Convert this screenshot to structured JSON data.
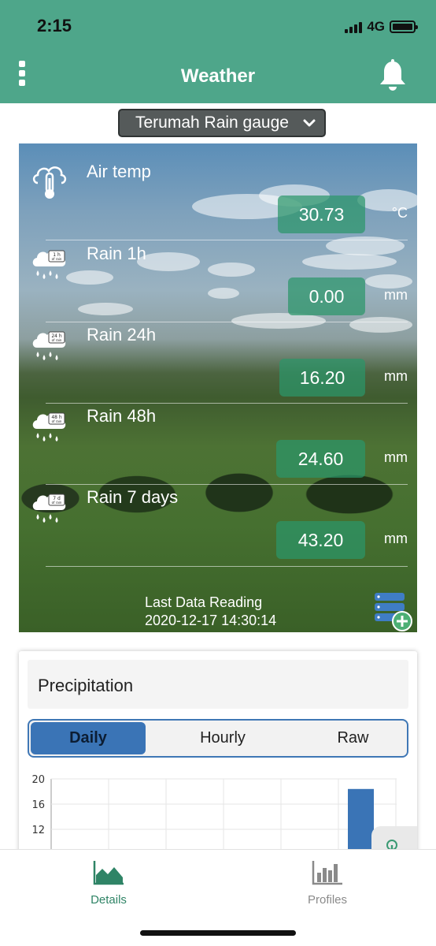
{
  "status_bar": {
    "time": "2:15",
    "network": "4G"
  },
  "header": {
    "title": "Weather",
    "menu_icon": "more-vertical-icon",
    "bell_icon": "bell-icon"
  },
  "device_selector": {
    "selected": "Terumah Rain gauge"
  },
  "readings": [
    {
      "label": "Air temp",
      "value": "30.73",
      "unit": "°C",
      "icon": "thermometer-cloud-icon",
      "badge": ""
    },
    {
      "label": "Rain 1h",
      "value": "0.00",
      "unit": "mm",
      "icon": "rain-cloud-icon",
      "badge": "1 h\nof rain"
    },
    {
      "label": "Rain 24h",
      "value": "16.20",
      "unit": "mm",
      "icon": "rain-cloud-icon",
      "badge": "24 h\nof rain"
    },
    {
      "label": "Rain 48h",
      "value": "24.60",
      "unit": "mm",
      "icon": "rain-cloud-icon",
      "badge": "48 h\nof rain"
    },
    {
      "label": "Rain 7 days",
      "value": "43.20",
      "unit": "mm",
      "icon": "rain-cloud-icon",
      "badge": "7 d\nof rain"
    }
  ],
  "last_reading": {
    "label": "Last Data Reading",
    "timestamp": "2020-12-17 14:30:14"
  },
  "precipitation": {
    "title": "Precipitation",
    "tabs": [
      {
        "label": "Daily",
        "active": true
      },
      {
        "label": "Hourly",
        "active": false
      },
      {
        "label": "Raw",
        "active": false
      }
    ]
  },
  "chart_data": {
    "type": "bar",
    "title": "",
    "y_ticks": [
      "20",
      "16",
      "12"
    ],
    "ylim": [
      0,
      20
    ],
    "grid": true,
    "visible_bars": [
      {
        "slot": 4,
        "value": 0.3
      },
      {
        "slot": 5,
        "value": 18.4
      }
    ],
    "bar_color": "#3a74b6"
  },
  "tab_bar": {
    "tabs": [
      {
        "label": "Details",
        "active": true,
        "icon": "area-chart-icon"
      },
      {
        "label": "Profiles",
        "active": false,
        "icon": "bar-chart-icon"
      }
    ]
  },
  "colors": {
    "header": "#4ea68a",
    "value_box": "#2b9669",
    "accent": "#3a74b6",
    "active_tab": "#2f8466"
  }
}
